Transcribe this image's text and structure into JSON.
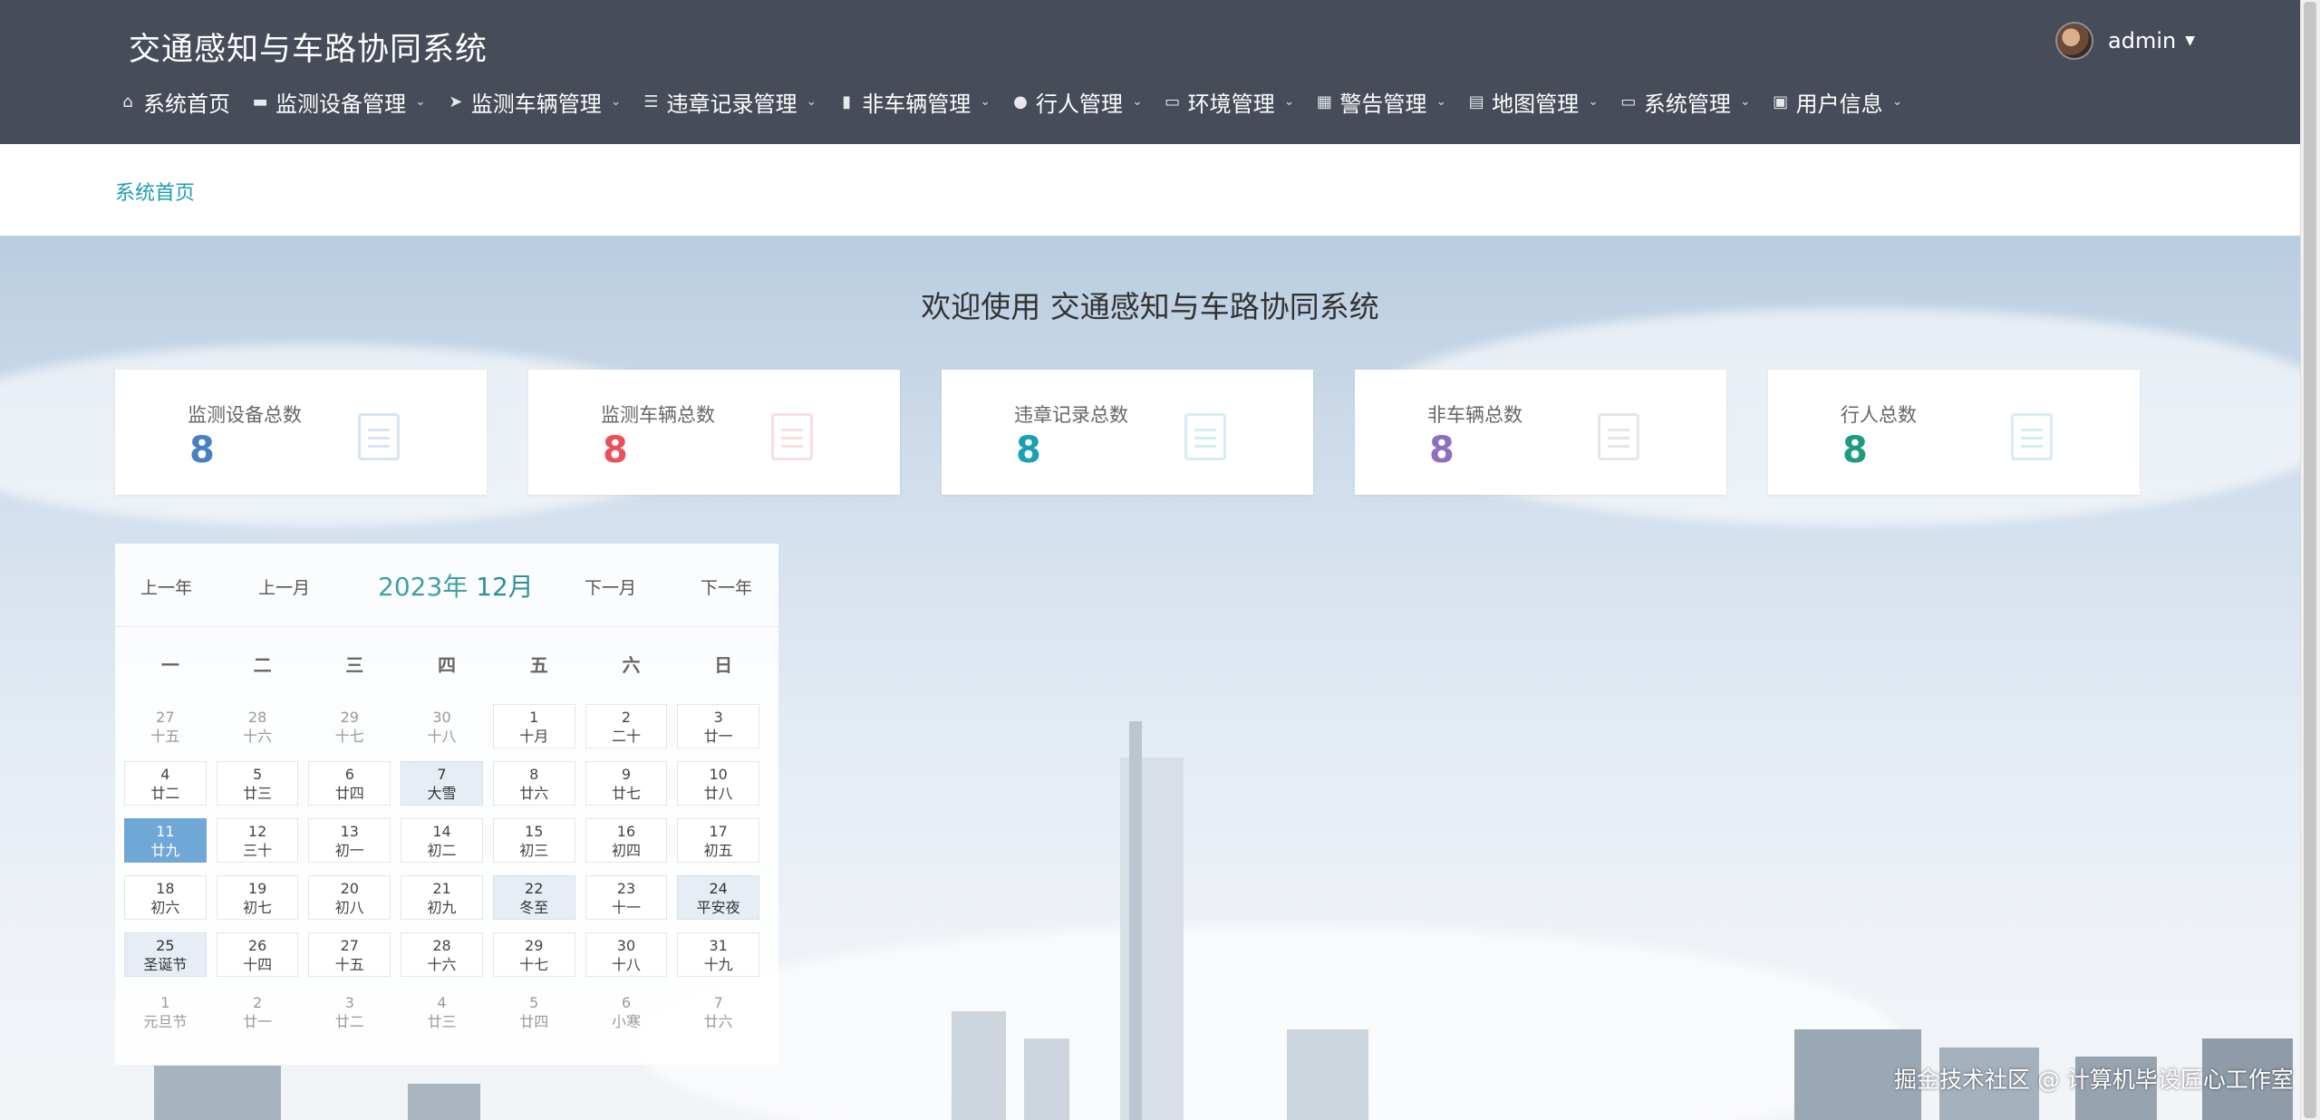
{
  "header": {
    "app_title": "交通感知与车路协同系统",
    "user_name": "admin"
  },
  "nav": [
    {
      "label": "系统首页",
      "icon": "home-icon",
      "glyph": "⌂",
      "dropdown": false
    },
    {
      "label": "监测设备管理",
      "icon": "briefcase-icon",
      "glyph": "▬",
      "dropdown": true
    },
    {
      "label": "监测车辆管理",
      "icon": "send-icon",
      "glyph": "➤",
      "dropdown": true
    },
    {
      "label": "违章记录管理",
      "icon": "sliders-icon",
      "glyph": "☰",
      "dropdown": true
    },
    {
      "label": "非车辆管理",
      "icon": "book-icon",
      "glyph": "▮",
      "dropdown": true
    },
    {
      "label": "行人管理",
      "icon": "person-icon",
      "glyph": "●",
      "dropdown": true
    },
    {
      "label": "环境管理",
      "icon": "comment-icon",
      "glyph": "▭",
      "dropdown": true
    },
    {
      "label": "警告管理",
      "icon": "grid-icon",
      "glyph": "▦",
      "dropdown": true
    },
    {
      "label": "地图管理",
      "icon": "clipboard-icon",
      "glyph": "▤",
      "dropdown": true
    },
    {
      "label": "系统管理",
      "icon": "monitor-icon",
      "glyph": "▭",
      "dropdown": true
    },
    {
      "label": "用户信息",
      "icon": "card-icon",
      "glyph": "▣",
      "dropdown": true
    }
  ],
  "breadcrumb": "系统首页",
  "welcome": "欢迎使用 交通感知与车路协同系统",
  "stats": [
    {
      "label": "监测设备总数",
      "value": "8",
      "color": "#4a7fc1",
      "icon": "clipboard-icon",
      "icon_color": "#8fb6dc"
    },
    {
      "label": "监测车辆总数",
      "value": "8",
      "color": "#e8505b",
      "icon": "file-icon",
      "icon_color": "#f0a2a8"
    },
    {
      "label": "违章记录总数",
      "value": "8",
      "color": "#1a9fb5",
      "icon": "clipboard-icon",
      "icon_color": "#7fcfdc"
    },
    {
      "label": "非车辆总数",
      "value": "8",
      "color": "#8e6fbf",
      "icon": "file-icon",
      "icon_color": "#b7b7c6"
    },
    {
      "label": "行人总数",
      "value": "8",
      "color": "#1e9a82",
      "icon": "clipboard-icon",
      "icon_color": "#7fcfdc"
    }
  ],
  "calendar": {
    "prev_year": "上一年",
    "prev_month": "上一月",
    "year_text": "2023年",
    "month_text": "12月",
    "next_month": "下一月",
    "next_year": "下一年",
    "weekdays": [
      "一",
      "二",
      "三",
      "四",
      "五",
      "六",
      "日"
    ],
    "weeks": [
      [
        [
          "27",
          "十五",
          "oth"
        ],
        [
          "28",
          "十六",
          "oth"
        ],
        [
          "29",
          "十七",
          "oth"
        ],
        [
          "30",
          "十八",
          "oth"
        ],
        [
          "1",
          "十月",
          "cur"
        ],
        [
          "2",
          "二十",
          "cur"
        ],
        [
          "3",
          "廿一",
          "cur"
        ]
      ],
      [
        [
          "4",
          "廿二",
          "cur"
        ],
        [
          "5",
          "廿三",
          "cur"
        ],
        [
          "6",
          "廿四",
          "cur"
        ],
        [
          "7",
          "大雪",
          "hol"
        ],
        [
          "8",
          "廿六",
          "cur"
        ],
        [
          "9",
          "廿七",
          "cur"
        ],
        [
          "10",
          "廿八",
          "cur"
        ]
      ],
      [
        [
          "11",
          "廿九",
          "today"
        ],
        [
          "12",
          "三十",
          "cur"
        ],
        [
          "13",
          "初一",
          "cur"
        ],
        [
          "14",
          "初二",
          "cur"
        ],
        [
          "15",
          "初三",
          "cur"
        ],
        [
          "16",
          "初四",
          "cur"
        ],
        [
          "17",
          "初五",
          "cur"
        ]
      ],
      [
        [
          "18",
          "初六",
          "cur"
        ],
        [
          "19",
          "初七",
          "cur"
        ],
        [
          "20",
          "初八",
          "cur"
        ],
        [
          "21",
          "初九",
          "cur"
        ],
        [
          "22",
          "冬至",
          "hol"
        ],
        [
          "23",
          "十一",
          "cur"
        ],
        [
          "24",
          "平安夜",
          "hol"
        ]
      ],
      [
        [
          "25",
          "圣诞节",
          "hol"
        ],
        [
          "26",
          "十四",
          "cur"
        ],
        [
          "27",
          "十五",
          "cur"
        ],
        [
          "28",
          "十六",
          "cur"
        ],
        [
          "29",
          "十七",
          "cur"
        ],
        [
          "30",
          "十八",
          "cur"
        ],
        [
          "31",
          "十九",
          "cur"
        ]
      ],
      [
        [
          "1",
          "元旦节",
          "oth"
        ],
        [
          "2",
          "廿一",
          "oth"
        ],
        [
          "3",
          "廿二",
          "oth"
        ],
        [
          "4",
          "廿三",
          "oth"
        ],
        [
          "5",
          "廿四",
          "oth"
        ],
        [
          "6",
          "小寒",
          "oth"
        ],
        [
          "7",
          "廿六",
          "oth"
        ]
      ]
    ]
  },
  "watermark": "掘金技术社区 @ 计算机毕设匠心工作室"
}
